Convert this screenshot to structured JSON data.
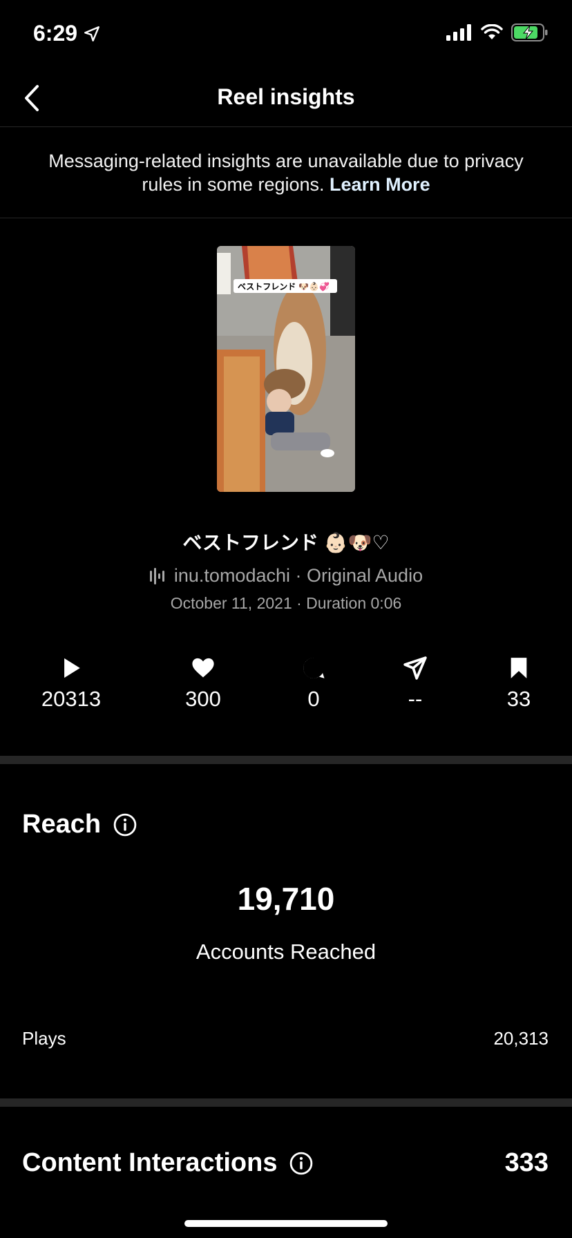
{
  "status_bar": {
    "time": "6:29",
    "icons": [
      "location-arrow-icon",
      "signal-icon",
      "wifi-icon",
      "battery-charging-icon"
    ],
    "battery_color": "#4cd964"
  },
  "nav": {
    "title": "Reel insights",
    "back_icon": "chevron-left-icon"
  },
  "notice": {
    "text": "Messaging-related insights are unavailable due to privacy rules in some regions.",
    "link": "Learn More"
  },
  "reel": {
    "thumbnail_caption": "ベストフレンド 🐶👶🏻💞",
    "title": "ベストフレンド 👶🏻🐶♡",
    "audio": "inu.tomodachi · Original Audio",
    "meta": "October 11, 2021 · Duration 0:06"
  },
  "metrics": [
    {
      "icon": "play-icon",
      "value": "20313"
    },
    {
      "icon": "heart-icon",
      "value": "300"
    },
    {
      "icon": "comment-icon",
      "value": "0"
    },
    {
      "icon": "share-icon",
      "value": "--"
    },
    {
      "icon": "bookmark-icon",
      "value": "33"
    }
  ],
  "reach": {
    "title": "Reach",
    "info_icon": "info-icon",
    "accounts_reached": "19,710",
    "accounts_reached_label": "Accounts Reached",
    "plays_label": "Plays",
    "plays_value": "20,313"
  },
  "interactions": {
    "title": "Content Interactions",
    "info_icon": "info-icon",
    "total": "333"
  }
}
